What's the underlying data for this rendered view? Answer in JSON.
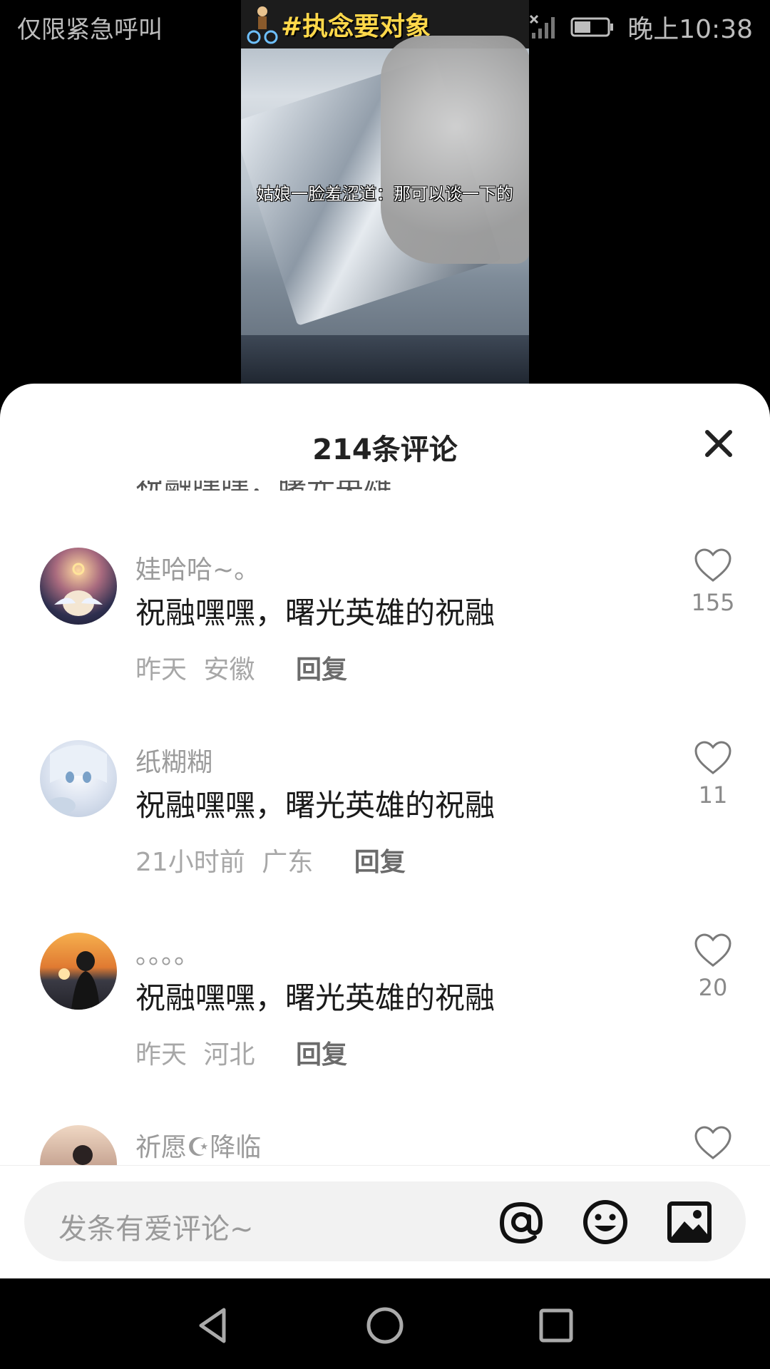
{
  "status_bar": {
    "left_text": "仅限紧急呼叫",
    "time": "晚上10:38",
    "icons": [
      "wifi-icon",
      "no-signal-icon",
      "battery-icon"
    ]
  },
  "video": {
    "topic_tag": "#执念要对象",
    "subtitle": "姑娘一脸羞涩道：那可以谈一下的"
  },
  "sheet": {
    "title": "214条评论",
    "partial_text": "祝融嘿嘿，曙光英雄"
  },
  "comments": [
    {
      "username": "娃哈哈~。",
      "text": "祝融嘿嘿，曙光英雄的祝融",
      "time": "昨天",
      "location": "安徽",
      "reply_label": "回复",
      "likes": "155"
    },
    {
      "username": "纸糊糊",
      "text": "祝融嘿嘿，曙光英雄的祝融",
      "time": "21小时前",
      "location": "广东",
      "reply_label": "回复",
      "likes": "11"
    },
    {
      "username": "。。。。",
      "text": "祝融嘿嘿，曙光英雄的祝融",
      "time": "昨天",
      "location": "河北",
      "reply_label": "回复",
      "likes": "20"
    },
    {
      "username": "祈愿☪降临",
      "text": "",
      "time": "",
      "location": "",
      "reply_label": "",
      "likes": ""
    }
  ],
  "input": {
    "placeholder": "发条有爱评论~",
    "icons": [
      "at-icon",
      "emoji-icon",
      "image-icon"
    ]
  },
  "colors": {
    "sheet_bg": "#ffffff",
    "input_bg": "#f2f2f2",
    "topic_yellow": "#ffd84a"
  }
}
